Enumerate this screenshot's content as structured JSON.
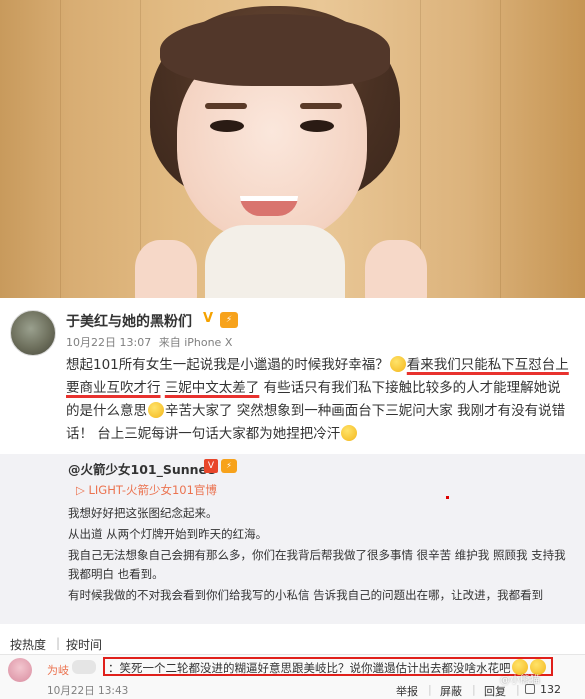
{
  "post": {
    "username": "于美红与她的黑粉们",
    "level_badge": "⚡",
    "date": "10月22日 13:07",
    "source": "来自 iPhone X",
    "text_segments": [
      {
        "t": "想起101所有女生一起说我是小邋遢的时候我好幸福？",
        "hl": false
      },
      {
        "t": "看来我们只能私下互怼台上要商业互吹才行",
        "hl": true
      },
      {
        "t": " ",
        "hl": false
      },
      {
        "t": "三妮中文太差了",
        "hl": true
      },
      {
        "t": " 有些话只有我们私下接触比较多的人才能理解她说的是什么意思",
        "hl": false
      },
      {
        "t": "辛苦大家了 突然想象到一种画面台下三妮问大家 我刚才有没有说错话！ 台上三妮每讲一句话大家都为她捏把冷汗",
        "hl": false
      }
    ]
  },
  "repost": {
    "username": "@火箭少女101_Sunnee",
    "v_badge": "V",
    "level_badge": "⚡",
    "link_text": "LIGHT-火箭少女101官博",
    "paragraphs": [
      "我想好好把这张图纪念起来。",
      "从出道 从两个灯牌开始到昨天的红海。",
      "我自己无法想象自己会拥有那么多，你们在我背后帮我做了很多事情 很辛苦 维护我 照顾我 支持我 我都明白 也看到。",
      "有时候我做的不对我会看到你们给我写的小私信 告诉我自己的问题出在哪，让改进，我都看到"
    ]
  },
  "tabs": {
    "hot": "按热度",
    "time": "按时间"
  },
  "comment": {
    "username": "为岐",
    "text": "笑死一个二轮都没进的糊逼好意思跟美岐比？说你邋遢估计出去都没啥水花吧",
    "date": "10月22日 13:43",
    "report": "举报",
    "block": "屏蔽",
    "reply": "回复",
    "likes": "132"
  },
  "watermark": "@小熊猫"
}
